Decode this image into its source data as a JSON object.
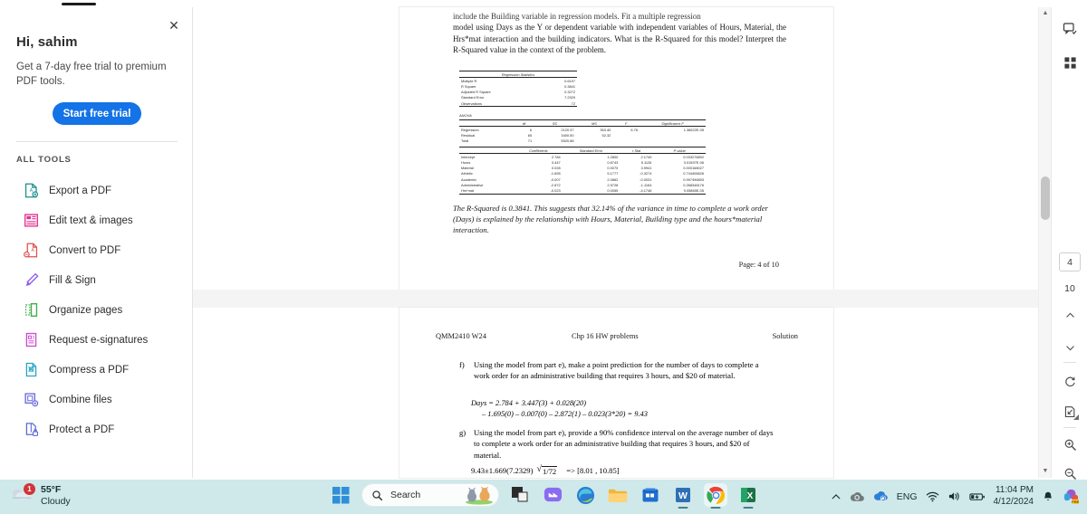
{
  "app": {
    "name": "Adobe Acrobat PDF viewer in browser"
  },
  "left_panel": {
    "close_label": "✕",
    "greeting": "Hi, sahim",
    "promo_text": "Get a 7-day free trial to premium PDF tools.",
    "trial_button": "Start free trial",
    "section_title": "ALL TOOLS",
    "tools": [
      {
        "label": "Export a PDF",
        "icon": "export-pdf-icon",
        "color": "#1a8f8f"
      },
      {
        "label": "Edit text & images",
        "icon": "edit-text-images-icon",
        "color": "#e1338f"
      },
      {
        "label": "Convert to PDF",
        "icon": "convert-to-pdf-icon",
        "color": "#e34f4f"
      },
      {
        "label": "Fill & Sign",
        "icon": "fill-and-sign-icon",
        "color": "#8b5cf0"
      },
      {
        "label": "Organize pages",
        "icon": "organize-pages-icon",
        "color": "#3fae49"
      },
      {
        "label": "Request e-signatures",
        "icon": "request-esignatures-icon",
        "color": "#c94fd0"
      },
      {
        "label": "Compress a PDF",
        "icon": "compress-pdf-icon",
        "color": "#25a5c4"
      },
      {
        "label": "Combine files",
        "icon": "combine-files-icon",
        "color": "#6b6be0"
      },
      {
        "label": "Protect a PDF",
        "icon": "protect-pdf-icon",
        "color": "#5b6bd6"
      }
    ]
  },
  "tool_rail": {
    "items": [
      {
        "name": "select-tool",
        "glyph": "cursor",
        "active": true
      },
      {
        "name": "comment-tool",
        "glyph": "comment",
        "active": false
      },
      {
        "name": "highlight-tool",
        "glyph": "marker",
        "active": false
      },
      {
        "name": "draw-tool",
        "glyph": "loop",
        "active": false
      },
      {
        "name": "add-text-tool",
        "glyph": "textbox",
        "active": false
      },
      {
        "name": "erase-tool",
        "glyph": "eraser",
        "active": false
      }
    ],
    "accent": "#1473e6"
  },
  "document": {
    "page1": {
      "intro_cut": "include the Building variable in regression models.  Fit a multiple regression",
      "intro": "model using Days as the Y or dependent variable with independent variables of Hours, Material, the Hrs*mat interaction and the building indicators.  What is the R-Squared for this model?  Interpret the R-Squared value in the context of the problem.",
      "regression_stats": {
        "title": "Regression Statistics",
        "rows": [
          {
            "label": "Multiple R",
            "value": "0.6197"
          },
          {
            "label": "R Square",
            "value": "0.3841"
          },
          {
            "label": "Adjusted R Square",
            "value": "0.3272"
          },
          {
            "label": "Standard Error",
            "value": "7.2329"
          },
          {
            "label": "Observations",
            "value": "72"
          }
        ]
      },
      "anova": {
        "title": "ANOVA",
        "headers": [
          "",
          "df",
          "SS",
          "MS",
          "F",
          "Significance F"
        ],
        "rows": [
          [
            "Regression",
            "6",
            "2120.37",
            "353.40",
            "6.76",
            "1.36522E-05"
          ],
          [
            "Residual",
            "65",
            "3400.50",
            "52.32",
            "",
            ""
          ],
          [
            "Total",
            "71",
            "5520.88",
            "",
            "",
            ""
          ]
        ]
      },
      "coefficients": {
        "headers": [
          "",
          "Coefficients",
          "Standard Error",
          "t Stat",
          "P-value"
        ],
        "rows": [
          [
            "Intercept",
            "2.784",
            "1.2800",
            "2.1749",
            "0.033278892"
          ],
          [
            "Hours",
            "3.447",
            "0.6743",
            "5.1126",
            "3.01597E-06"
          ],
          [
            "Material",
            "0.028",
            "0.0070",
            "3.9941",
            "0.000168027"
          ],
          [
            "Athletic",
            "-1.695",
            "5.1777",
            "-0.3274",
            "0.744406626"
          ],
          [
            "Academic",
            "-0.007",
            "2.0862",
            "-0.0031",
            "0.997496893"
          ],
          [
            "Administrative",
            "-2.872",
            "2.5728",
            "-1.1164",
            "0.268348176"
          ],
          [
            "Hrs*mat",
            "-0.023",
            "0.0055",
            "-4.1746",
            "9.05865E-05"
          ]
        ]
      },
      "interpretation": "The R-Squared is 0.3841.  This suggests that 32.14% of the variance in time to complete a work order (Days) is explained by the relationship with Hours, Material, Building type and the hours*material interaction.",
      "page_label": "Page: 4 of 10"
    },
    "page2": {
      "header_left": "QMM2410 W24",
      "header_center": "Chp 16 HW problems",
      "header_right": "Solution",
      "question_f": {
        "letter": "f)",
        "text": "Using the model from part e), make a point prediction for the number of days to complete a work order for an administrative building that requires 3 hours, and $20 of material."
      },
      "equation_line1": "Days = 2.784 + 3.447(3) + 0.028(20)",
      "equation_line2": "– 1.695(0) – 0.007(0) – 2.872(1) – 0.023(3*20) = 9.43",
      "question_g": {
        "letter": "g)",
        "text": "Using the model from part e), provide a 90% confidence interval on the average number of days to complete a work order for an administrative building that requires 3 hours, and $20 of material."
      },
      "ci_expression": "9.43±1.669(7.2329)",
      "ci_radical": "1/72",
      "ci_result": "=>  [8.01 , 10.85]"
    }
  },
  "right_rail": {
    "comment_icon": "comment-panel-icon",
    "thumbnails_icon": "page-thumbnails-icon",
    "current_page": "4",
    "total_pages": "10",
    "prev_label": "⌃",
    "next_label": "⌄",
    "rotate_icon": "rotate-clockwise-icon",
    "fitpage_icon": "fit-page-icon",
    "zoom_in_icon": "zoom-in-icon",
    "zoom_out_icon": "zoom-out-icon"
  },
  "taskbar": {
    "weather_temp": "55°F",
    "weather_cond": "Cloudy",
    "weather_badge": "1",
    "search_placeholder": "Search",
    "apps": [
      {
        "name": "start-button",
        "label": "Start"
      },
      {
        "name": "widgets-pets-icon",
        "label": "Widgets"
      },
      {
        "name": "task-view-icon",
        "label": "Task view"
      },
      {
        "name": "chat-teams-icon",
        "label": "Chat"
      },
      {
        "name": "edge-icon",
        "label": "Microsoft Edge"
      },
      {
        "name": "file-explorer-icon",
        "label": "File Explorer"
      },
      {
        "name": "microsoft-store-icon",
        "label": "Microsoft Store"
      },
      {
        "name": "word-icon",
        "label": "Word"
      },
      {
        "name": "chrome-icon",
        "label": "Google Chrome"
      },
      {
        "name": "excel-icon",
        "label": "Excel"
      }
    ],
    "tray": {
      "overflow": "⌃",
      "language": "ENG",
      "time": "11:04 PM",
      "date": "4/12/2024"
    }
  }
}
